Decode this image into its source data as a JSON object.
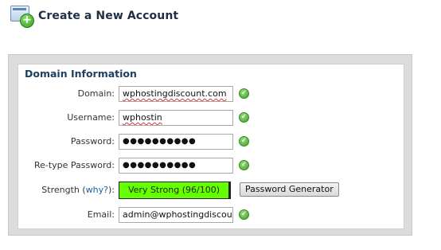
{
  "header": {
    "title": "Create a New Account",
    "icon": "new-account-icon"
  },
  "section": {
    "title": "Domain Information"
  },
  "form": {
    "domain": {
      "label": "Domain:",
      "value": "wphostingdiscount.com"
    },
    "username": {
      "label": "Username:",
      "value": "wphostin"
    },
    "password": {
      "label": "Password:",
      "value": "●●●●●●●●●●"
    },
    "retype_password": {
      "label": "Re-type Password:",
      "value": "●●●●●●●●●●"
    },
    "strength": {
      "label": "Strength (",
      "link": "why?",
      "label_end": "):",
      "value": "Very Strong (96/100)",
      "color": "#66ff00"
    },
    "password_generator_label": "Password Generator",
    "email": {
      "label": "Email:",
      "value": "admin@wphostingdiscount"
    }
  },
  "colors": {
    "title": "#1f2f46",
    "section_title": "#1d3f62",
    "link": "#1a5fa8",
    "valid_check": "#3f9a2a"
  }
}
